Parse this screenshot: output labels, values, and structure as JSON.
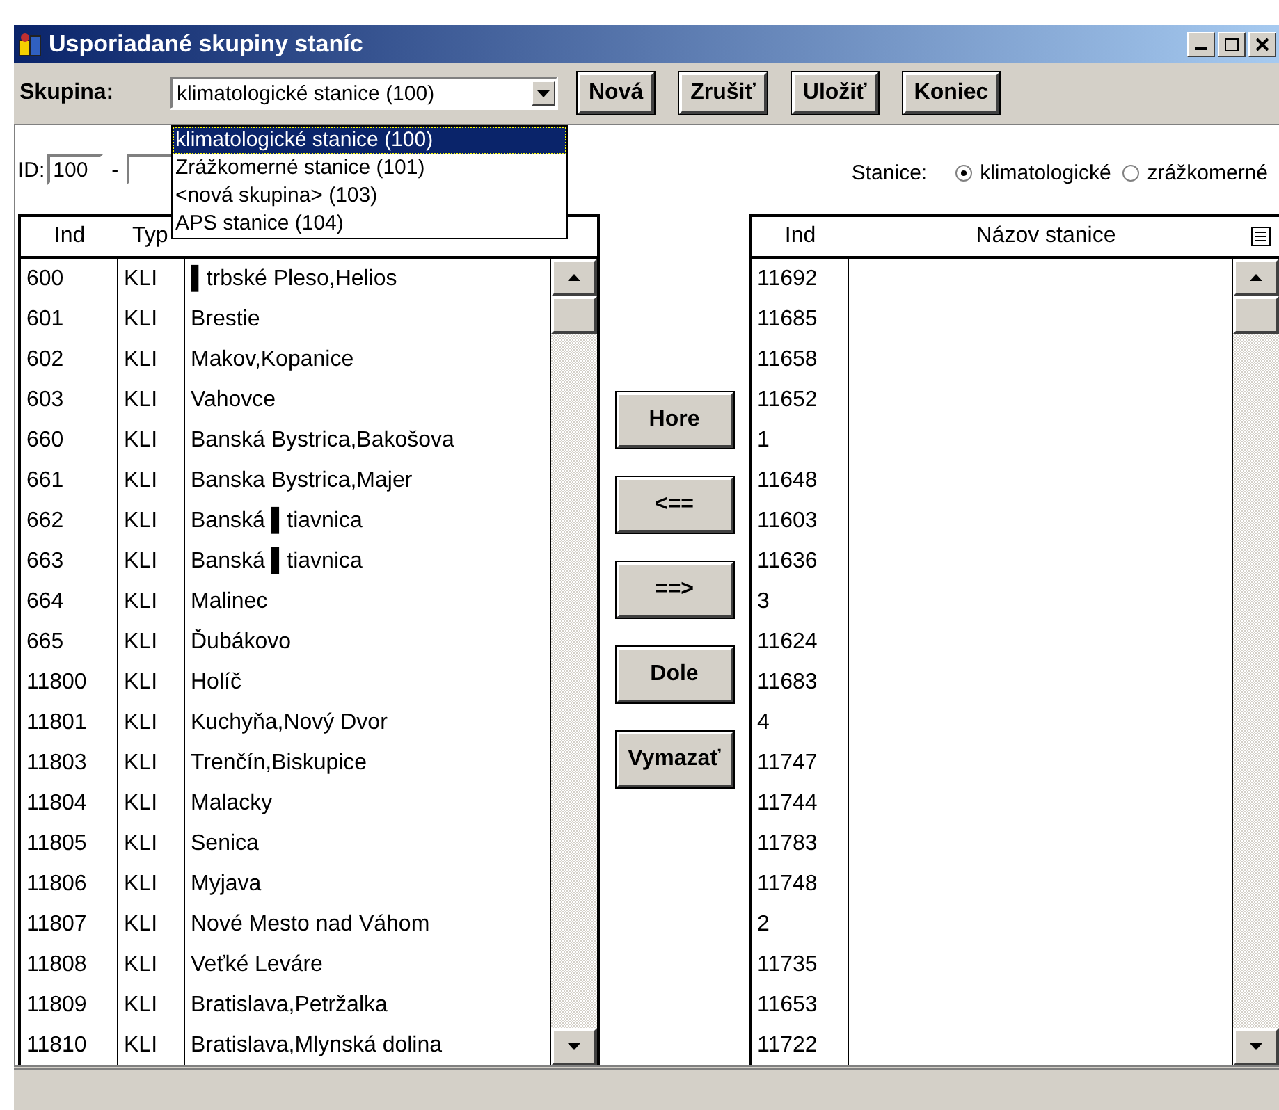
{
  "window": {
    "title": "Usporiadané skupiny staníc"
  },
  "toolbar": {
    "group_label": "Skupina:",
    "group_value": "klimatologické stanice (100)",
    "buttons": [
      "Nová",
      "Zrušiť",
      "Uložiť",
      "Koniec"
    ]
  },
  "group_dropdown": {
    "options": [
      {
        "label": "klimatologické stanice (100)",
        "selected": true
      },
      {
        "label": "Zrážkomerné stanice (101)",
        "selected": false
      },
      {
        "label": "<nová skupina> (103)",
        "selected": false
      },
      {
        "label": "APS stanice (104)",
        "selected": false
      }
    ]
  },
  "filter": {
    "id_label": "ID:",
    "id_value": "100",
    "separator": "-"
  },
  "station_type": {
    "label": "Stanice:",
    "options": [
      {
        "label": "klimatologické",
        "selected": true
      },
      {
        "label": "zrážkomerné",
        "selected": false
      }
    ]
  },
  "left_table": {
    "columns": [
      "Ind",
      "Typ"
    ],
    "rows": [
      {
        "ind": "600",
        "type": "KLI",
        "name": "▌trbské Pleso,Helios"
      },
      {
        "ind": "601",
        "type": "KLI",
        "name": "Brestie"
      },
      {
        "ind": "602",
        "type": "KLI",
        "name": "Makov,Kopanice"
      },
      {
        "ind": "603",
        "type": "KLI",
        "name": "Vahovce"
      },
      {
        "ind": "660",
        "type": "KLI",
        "name": "Banská Bystrica,Bakošova"
      },
      {
        "ind": "661",
        "type": "KLI",
        "name": "Banska Bystrica,Majer"
      },
      {
        "ind": "662",
        "type": "KLI",
        "name": "Banská ▌tiavnica"
      },
      {
        "ind": "663",
        "type": "KLI",
        "name": "Banská ▌tiavnica"
      },
      {
        "ind": "664",
        "type": "KLI",
        "name": "Malinec"
      },
      {
        "ind": "665",
        "type": "KLI",
        "name": "Ďubákovo"
      },
      {
        "ind": "11800",
        "type": "KLI",
        "name": "Holíč"
      },
      {
        "ind": "11801",
        "type": "KLI",
        "name": "Kuchyňa,Nový Dvor"
      },
      {
        "ind": "11803",
        "type": "KLI",
        "name": "Trenčín,Biskupice"
      },
      {
        "ind": "11804",
        "type": "KLI",
        "name": "Malacky"
      },
      {
        "ind": "11805",
        "type": "KLI",
        "name": "Senica"
      },
      {
        "ind": "11806",
        "type": "KLI",
        "name": "Myjava"
      },
      {
        "ind": "11807",
        "type": "KLI",
        "name": "Nové Mesto nad Váhom"
      },
      {
        "ind": "11808",
        "type": "KLI",
        "name": "Veťké Leváre"
      },
      {
        "ind": "11809",
        "type": "KLI",
        "name": "Bratislava,Petržalka"
      },
      {
        "ind": "11810",
        "type": "KLI",
        "name": "Bratislava,Mlynská dolina"
      }
    ]
  },
  "move_buttons": [
    "Hore",
    "<==",
    "==>",
    "Dole",
    "Vymazať"
  ],
  "right_table": {
    "columns": [
      "Ind",
      "Názov stanice"
    ],
    "rows": [
      {
        "ind": "11692"
      },
      {
        "ind": "11685"
      },
      {
        "ind": "11658"
      },
      {
        "ind": "11652"
      },
      {
        "ind": "1"
      },
      {
        "ind": "11648"
      },
      {
        "ind": "11603"
      },
      {
        "ind": "11636"
      },
      {
        "ind": "3"
      },
      {
        "ind": "11624"
      },
      {
        "ind": "11683"
      },
      {
        "ind": "4"
      },
      {
        "ind": "11747"
      },
      {
        "ind": "11744"
      },
      {
        "ind": "11783"
      },
      {
        "ind": "11748"
      },
      {
        "ind": "2"
      },
      {
        "ind": "11735"
      },
      {
        "ind": "11653"
      },
      {
        "ind": "11722"
      }
    ]
  }
}
